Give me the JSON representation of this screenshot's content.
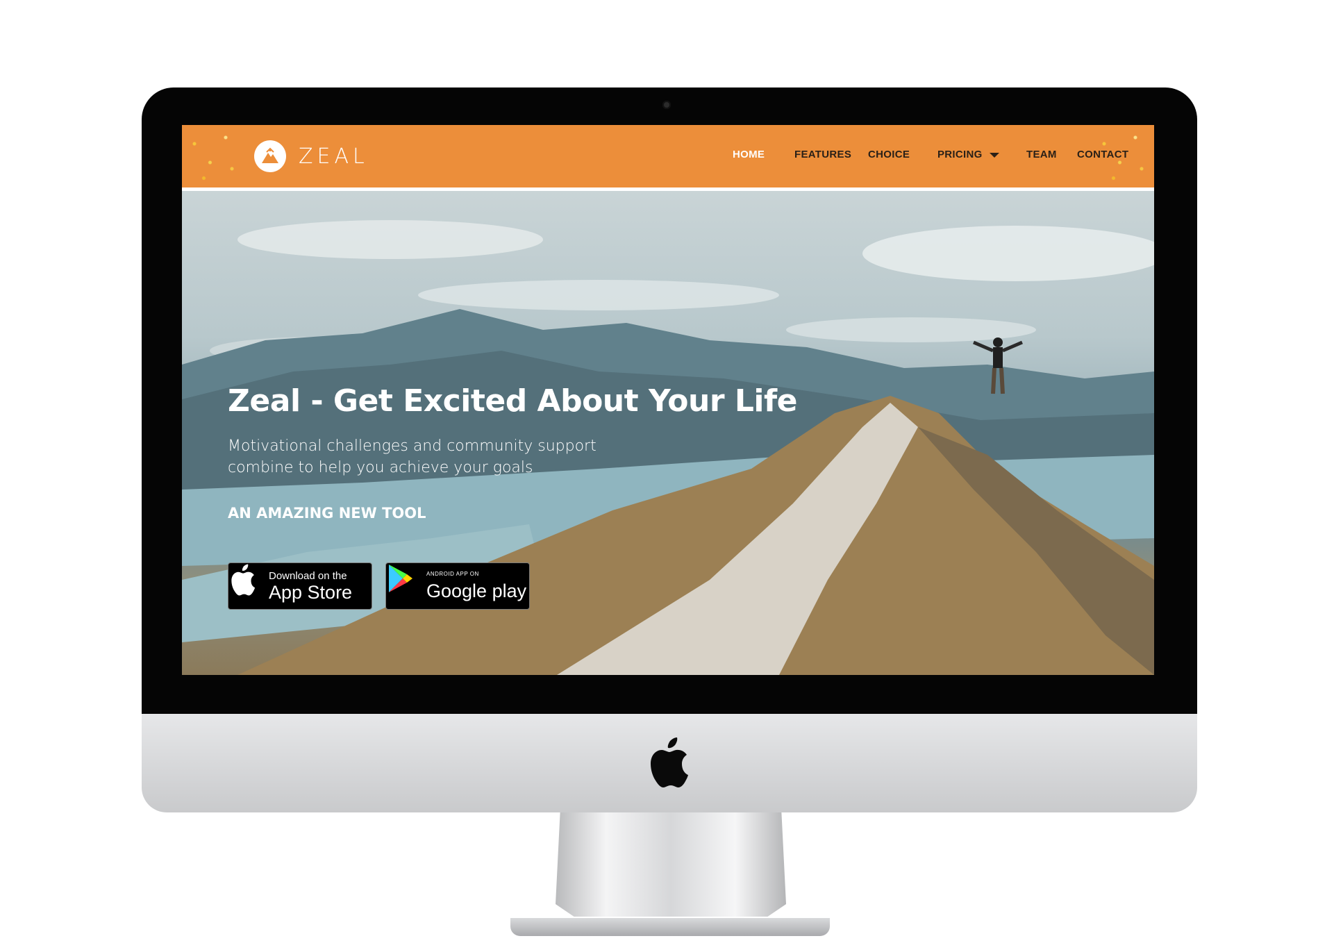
{
  "brand": {
    "name": "ZEAL",
    "accent_color": "#ec8e3a",
    "logo_icon": "mountain-peak-icon"
  },
  "nav": {
    "items": [
      {
        "label": "HOME",
        "active": true
      },
      {
        "label": "FEATURES",
        "active": false
      },
      {
        "label": "CHOICE",
        "active": false
      },
      {
        "label": "PRICING",
        "active": false,
        "dropdown": true
      },
      {
        "label": "TEAM",
        "active": false
      },
      {
        "label": "CONTACT",
        "active": false
      }
    ]
  },
  "hero": {
    "title": "Zeal - Get Excited About Your Life",
    "subtitle_line1": "Motivational challenges and community support",
    "subtitle_line2": "combine to help you achieve your goals",
    "tagline": "AN AMAZING NEW TOOL",
    "background_image": "mountain-summit-hiker-photo"
  },
  "store_badges": {
    "apple": {
      "small_text": "Download on the",
      "big_text": "App Store",
      "icon": "apple-icon"
    },
    "google": {
      "small_text": "ANDROID APP ON",
      "big_text": "Google play",
      "icon": "google-play-icon"
    }
  },
  "device": {
    "frame": "imac",
    "logo_icon": "apple-icon"
  }
}
